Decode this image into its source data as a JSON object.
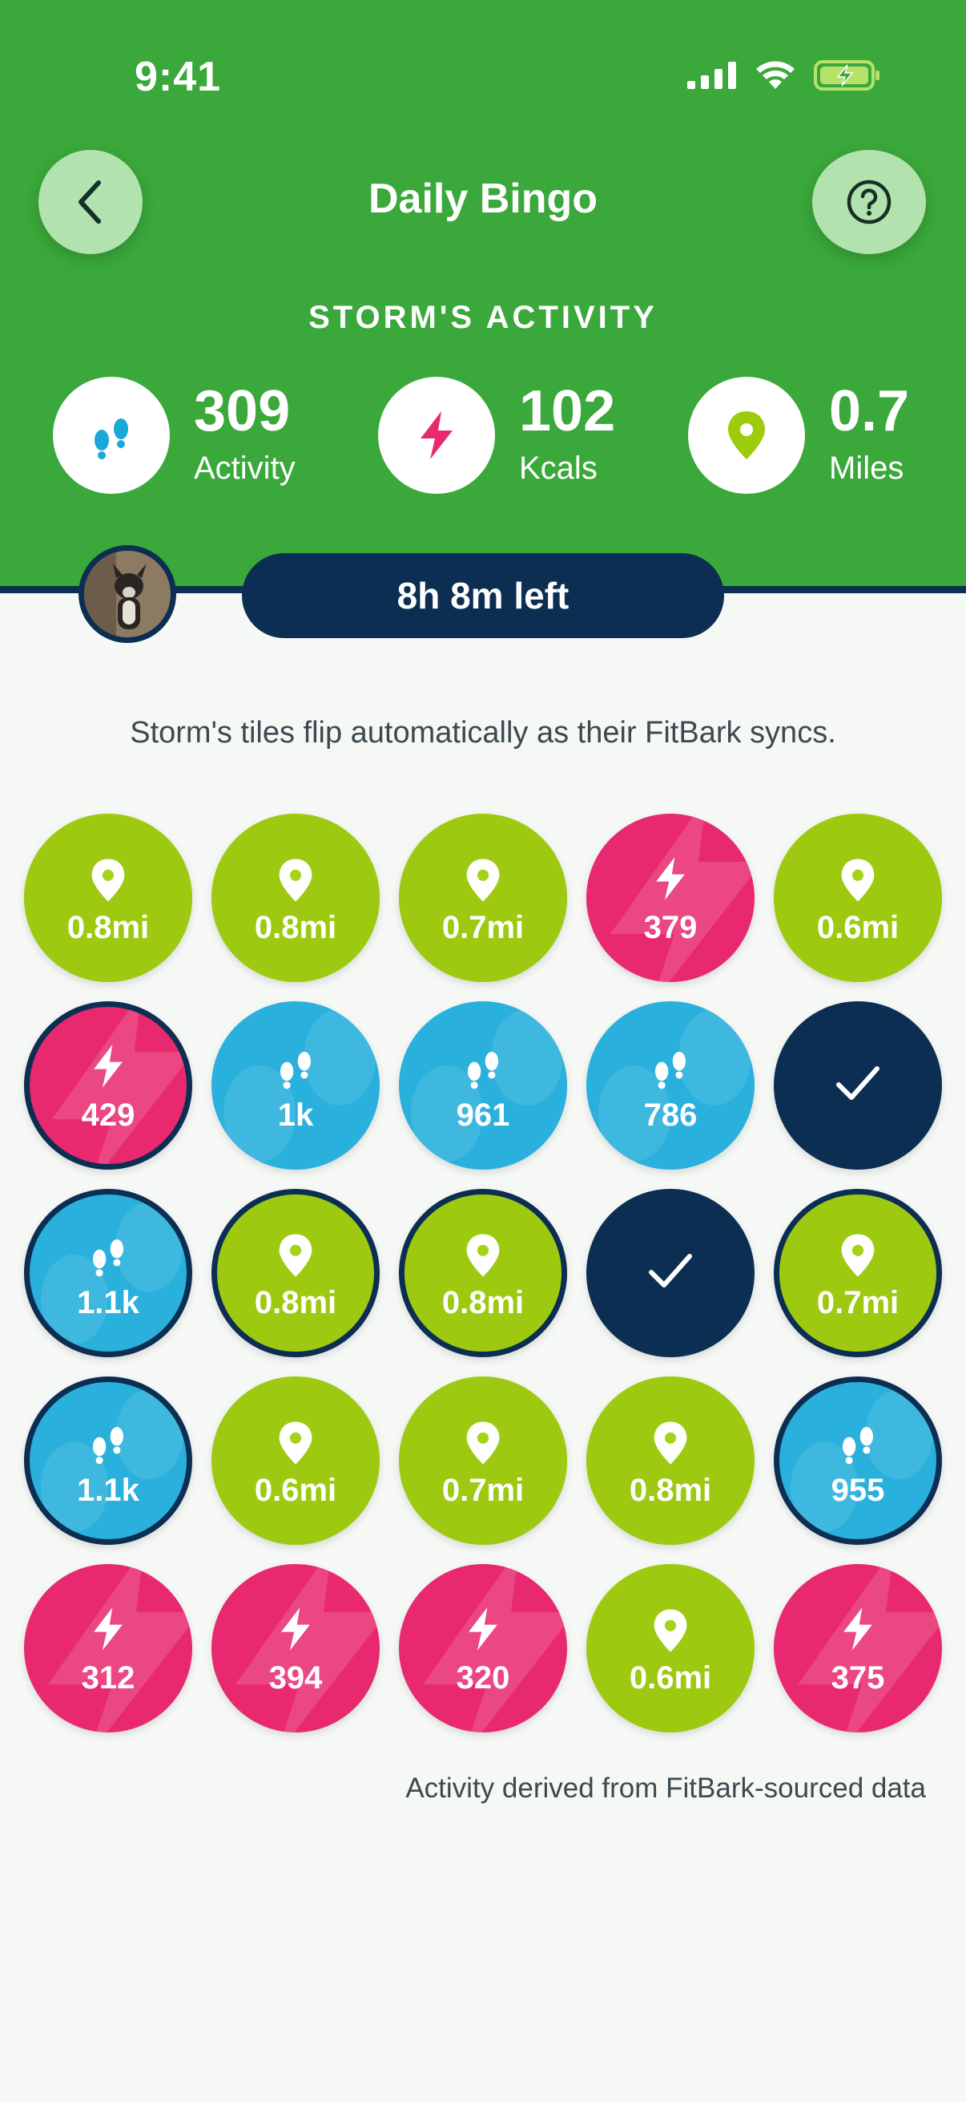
{
  "status_bar": {
    "time": "9:41",
    "icons": [
      "signal-icon",
      "wifi-icon",
      "battery-charging-icon"
    ]
  },
  "header": {
    "title": "Daily Bingo",
    "subtitle": "STORM'S ACTIVITY",
    "back_icon": "chevron-left-icon",
    "help_icon": "question-icon"
  },
  "stats": [
    {
      "value": "309",
      "label": "Activity",
      "icon": "paw-steps-icon",
      "color": "#1aa8d8"
    },
    {
      "value": "102",
      "label": "Kcals",
      "icon": "lightning-icon",
      "color": "#e8296f"
    },
    {
      "value": "0.7",
      "label": "Miles",
      "icon": "location-pin-icon",
      "color": "#9ccc0c"
    }
  ],
  "timer": {
    "label": "8h 8m left"
  },
  "description": "Storm's tiles flip automatically as their FitBark syncs.",
  "colors": {
    "header": "#3aa83a",
    "navy": "#0c2e52",
    "miles": "#a6d21a",
    "kcals": "#e8296f",
    "activity": "#2ab0dc"
  },
  "tiles": [
    [
      {
        "type": "miles",
        "value": "0.8mi",
        "outlined": false
      },
      {
        "type": "miles",
        "value": "0.8mi",
        "outlined": false
      },
      {
        "type": "miles",
        "value": "0.7mi",
        "outlined": false
      },
      {
        "type": "kcals",
        "value": "379",
        "outlined": false
      },
      {
        "type": "miles",
        "value": "0.6mi",
        "outlined": false
      }
    ],
    [
      {
        "type": "kcals",
        "value": "429",
        "outlined": true
      },
      {
        "type": "activity",
        "value": "1k",
        "outlined": false
      },
      {
        "type": "activity",
        "value": "961",
        "outlined": false
      },
      {
        "type": "activity",
        "value": "786",
        "outlined": false
      },
      {
        "type": "check",
        "value": "",
        "outlined": false
      }
    ],
    [
      {
        "type": "activity",
        "value": "1.1k",
        "outlined": true
      },
      {
        "type": "miles",
        "value": "0.8mi",
        "outlined": true
      },
      {
        "type": "miles",
        "value": "0.8mi",
        "outlined": true
      },
      {
        "type": "check",
        "value": "",
        "outlined": false
      },
      {
        "type": "miles",
        "value": "0.7mi",
        "outlined": true
      }
    ],
    [
      {
        "type": "activity",
        "value": "1.1k",
        "outlined": true
      },
      {
        "type": "miles",
        "value": "0.6mi",
        "outlined": false
      },
      {
        "type": "miles",
        "value": "0.7mi",
        "outlined": false
      },
      {
        "type": "miles",
        "value": "0.8mi",
        "outlined": false
      },
      {
        "type": "activity",
        "value": "955",
        "outlined": true
      }
    ],
    [
      {
        "type": "kcals",
        "value": "312",
        "outlined": false
      },
      {
        "type": "kcals",
        "value": "394",
        "outlined": false
      },
      {
        "type": "kcals",
        "value": "320",
        "outlined": false
      },
      {
        "type": "miles",
        "value": "0.6mi",
        "outlined": false
      },
      {
        "type": "kcals",
        "value": "375",
        "outlined": false
      }
    ]
  ],
  "footnote": "Activity derived from FitBark-sourced data"
}
